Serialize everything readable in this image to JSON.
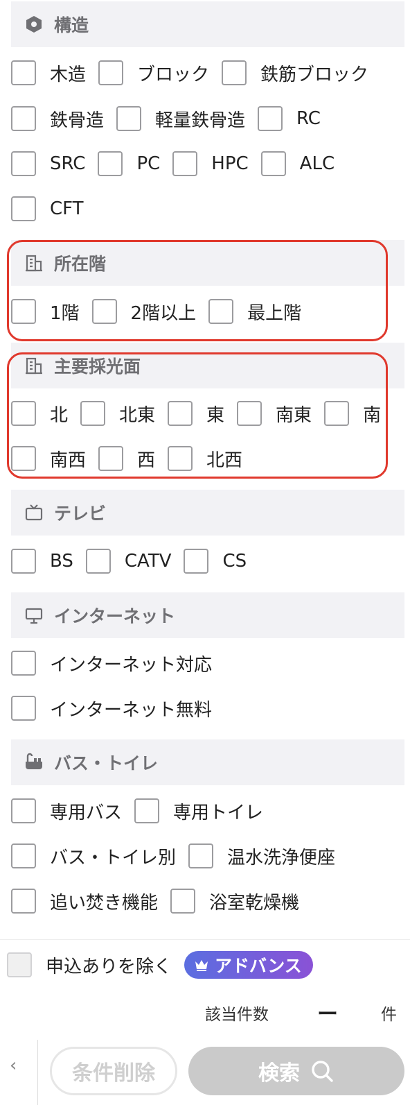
{
  "sections": {
    "structure": {
      "title": "構造",
      "options": [
        "木造",
        "ブロック",
        "鉄筋ブロック",
        "鉄骨造",
        "軽量鉄骨造",
        "RC",
        "SRC",
        "PC",
        "HPC",
        "ALC",
        "CFT"
      ]
    },
    "floor": {
      "title": "所在階",
      "options": [
        "1階",
        "2階以上",
        "最上階"
      ]
    },
    "lighting": {
      "title": "主要採光面",
      "options": [
        "北",
        "北東",
        "東",
        "南東",
        "南",
        "南西",
        "西",
        "北西"
      ]
    },
    "tv": {
      "title": "テレビ",
      "options": [
        "BS",
        "CATV",
        "CS"
      ]
    },
    "internet": {
      "title": "インターネット",
      "options": [
        "インターネット対応",
        "インターネット無料"
      ]
    },
    "bath": {
      "title": "バス・トイレ",
      "options": [
        "専用バス",
        "専用トイレ",
        "バス・トイレ別",
        "温水洗浄便座",
        "追い焚き機能",
        "浴室乾燥機"
      ]
    }
  },
  "footer": {
    "exclude_label": "申込ありを除く",
    "advance_badge": "アドバンス",
    "count_label": "該当件数",
    "count_value": "ー",
    "count_unit": "件",
    "back_label": "‹",
    "clear_label": "条件削除",
    "search_label": "検索"
  },
  "colors": {
    "highlight": "#e0392d",
    "header_bg": "#f2f2f5",
    "advance_gradient": [
      "#5b6ee0",
      "#8a52d6"
    ]
  }
}
